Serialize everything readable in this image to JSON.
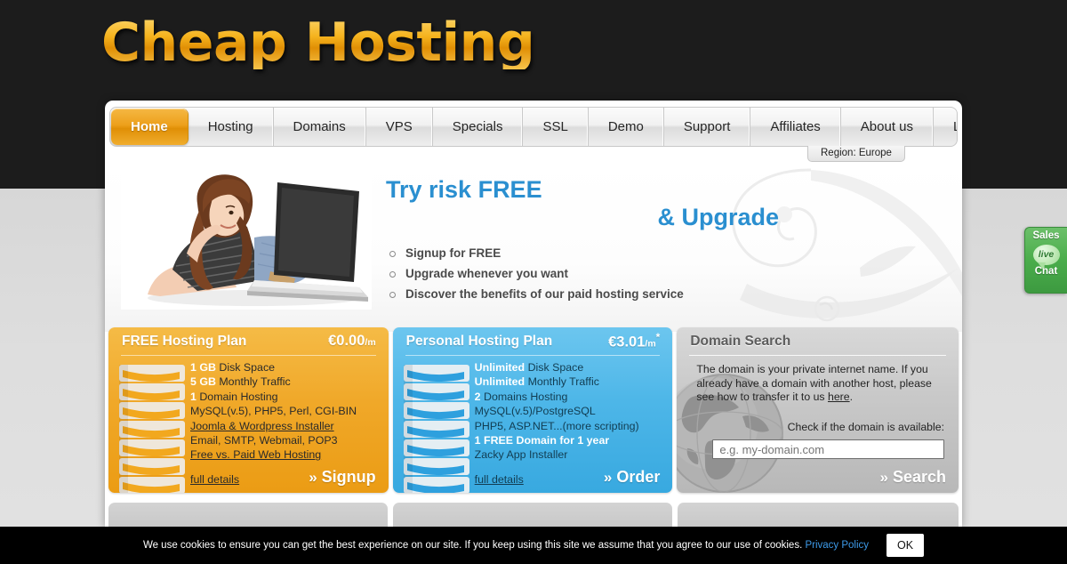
{
  "site": {
    "logo": "Cheap Hosting"
  },
  "nav": {
    "items": [
      {
        "label": "Home",
        "active": true
      },
      {
        "label": "Hosting",
        "active": false
      },
      {
        "label": "Domains",
        "active": false
      },
      {
        "label": "VPS",
        "active": false
      },
      {
        "label": "Specials",
        "active": false
      },
      {
        "label": "SSL",
        "active": false
      },
      {
        "label": "Demo",
        "active": false
      },
      {
        "label": "Support",
        "active": false
      },
      {
        "label": "Affiliates",
        "active": false
      },
      {
        "label": "About us",
        "active": false
      },
      {
        "label": "Login",
        "active": false
      }
    ],
    "region_badge": "Region: Europe"
  },
  "hero": {
    "headline_line1": "Try risk FREE",
    "headline_line2": "& Upgrade",
    "bullets": [
      "Signup for FREE",
      "Upgrade whenever you want",
      "Discover the benefits of our paid hosting service"
    ]
  },
  "plans": {
    "free": {
      "title": "FREE Hosting Plan",
      "price": "€0.00",
      "price_period": "/m",
      "price_star": "",
      "features": [
        {
          "highlight": "1 GB",
          "text": " Disk Space",
          "link": false
        },
        {
          "highlight": "5 GB",
          "text": " Monthly Traffic",
          "link": false
        },
        {
          "highlight": "1",
          "text": " Domain Hosting",
          "link": false
        },
        {
          "highlight": "",
          "text": "MySQL(v.5), PHP5, Perl, CGI-BIN",
          "link": false
        },
        {
          "highlight": "",
          "text": "Joomla & Wordpress Installer",
          "link": true
        },
        {
          "highlight": "",
          "text": "Email, SMTP, Webmail, POP3",
          "link": false
        },
        {
          "highlight": "",
          "text": "Free vs. Paid Web Hosting",
          "link": true
        }
      ],
      "details_label": "full details",
      "cta_label": "Signup"
    },
    "personal": {
      "title": "Personal Hosting Plan",
      "price": "€3.01",
      "price_period": "/m",
      "price_star": "*",
      "features": [
        {
          "highlight": "Unlimited",
          "text": " Disk Space",
          "link": false
        },
        {
          "highlight": "Unlimited",
          "text": " Monthly Traffic",
          "link": false
        },
        {
          "highlight": "2",
          "text": " Domains Hosting",
          "link": false
        },
        {
          "highlight": "",
          "text": "MySQL(v.5)/PostgreSQL",
          "link": false
        },
        {
          "highlight": "",
          "text": "PHP5, ASP.NET...(more scripting)",
          "link": false,
          "partial_link": "(more scripting)"
        },
        {
          "highlight": "1 FREE Domain for 1 year",
          "text": "",
          "link": false
        },
        {
          "highlight": "",
          "text": "Zacky App Installer",
          "link": false
        }
      ],
      "details_label": "full details",
      "cta_label": "Order"
    }
  },
  "domain_search": {
    "title": "Domain Search",
    "description_before": "The domain is your private internet name. If you already have a domain with another host, please see how to transfer it to us ",
    "description_link": "here",
    "description_after": ".",
    "check_label": "Check if the domain is available:",
    "input_placeholder": "e.g. my-domain.com",
    "input_value": "",
    "cta_label": "Search"
  },
  "chat_widget": {
    "top_label": "Sales",
    "bubble_label": "live",
    "bottom_label": "Chat"
  },
  "cookie_bar": {
    "message": "We use cookies to ensure you can get the best experience on our site. If you keep using this site we assume that you agree to our use of cookies. ",
    "privacy_link": "Privacy Policy",
    "ok_label": "OK"
  },
  "colors": {
    "brand_orange": "#f0a81c",
    "accent_blue": "#2a8fd0",
    "free_card": "#f0a829",
    "personal_card": "#4db6e8",
    "domain_card": "#c9c9c9",
    "chat_green": "#4aad4b",
    "header_dark": "#1c1c1c",
    "cookie_link": "#3d9ae8"
  }
}
